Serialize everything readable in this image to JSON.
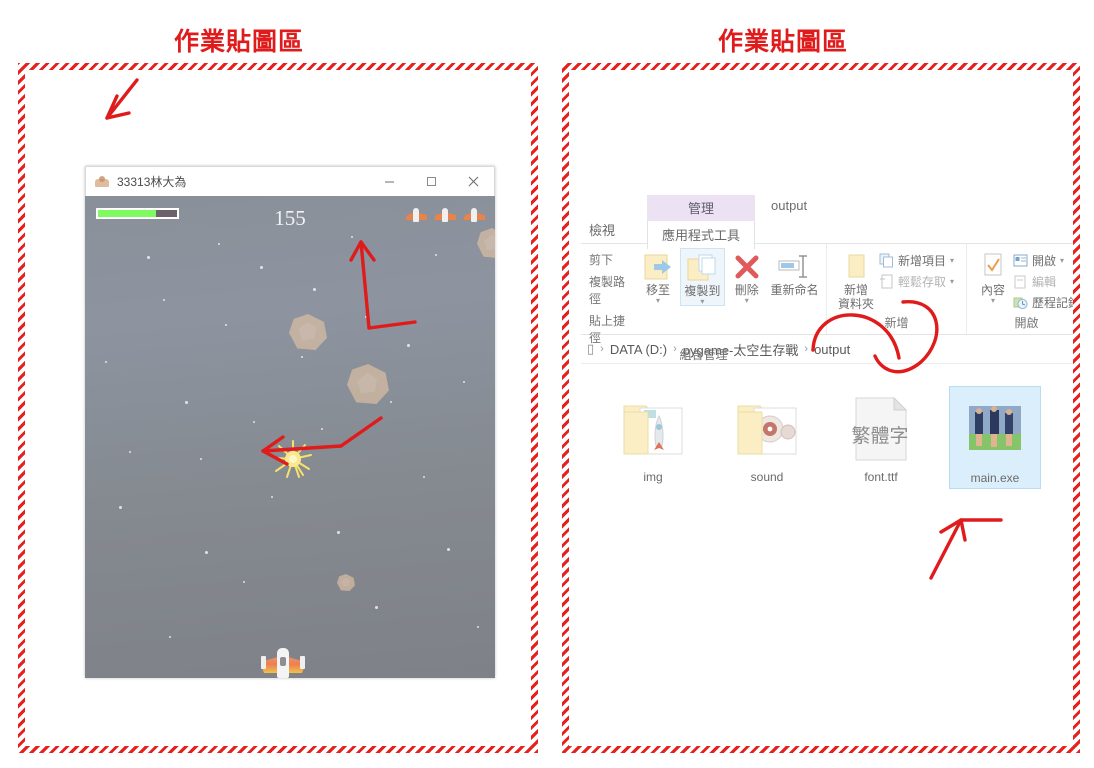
{
  "panels": {
    "left_title": "作業貼圖區",
    "right_title": "作業貼圖區"
  },
  "game_window": {
    "title": "33313林大為",
    "icon": "ship-icon",
    "window_buttons": {
      "minimize": "minimize-icon",
      "maximize": "maximize-icon",
      "close": "close-icon"
    },
    "hud": {
      "score": "155",
      "health_percent": 73,
      "lives": 3
    }
  },
  "explorer": {
    "tabs": {
      "view": "檢視",
      "manage_head": "管理",
      "manage_sub": "應用程式工具",
      "window_title": "output"
    },
    "ribbon": {
      "clipboard": {
        "items": [
          "剪下",
          "複製路徑",
          "貼上捷徑"
        ],
        "move_to": "移至",
        "copy_to": "複製到",
        "delete": "刪除",
        "rename": "重新命名",
        "group_label": "組合管理"
      },
      "new": {
        "new_folder": "新增\n資料夾",
        "new_folder_line1": "新增",
        "new_folder_line2": "資料夾",
        "new_item": "新增項目",
        "easy_access": "輕鬆存取",
        "group_label": "新增"
      },
      "open": {
        "properties": "內容",
        "open": "開啟",
        "edit": "編輯",
        "history": "歷程記錄",
        "group_label": "開啟"
      }
    },
    "breadcrumb": {
      "root": "",
      "items": [
        "DATA (D:)",
        "pygame-太空生存戰",
        "output"
      ]
    },
    "files": [
      {
        "name": "img",
        "type": "folder-rocket-icon",
        "selected": false
      },
      {
        "name": "sound",
        "type": "folder-disc-icon",
        "selected": false
      },
      {
        "name": "font.ttf",
        "type": "font-file-icon",
        "selected": false,
        "preview_text": "繁體字"
      },
      {
        "name": "main.exe",
        "type": "exe-thumbnail-icon",
        "selected": true
      }
    ]
  },
  "annotations": {
    "color": "#e01b1b",
    "marks": [
      "arrow-to-window-title",
      "arrow-hook-right-of-asteroid",
      "arrow-to-explosion",
      "circle-around-new-folder",
      "circle-around-breadcrumb-output",
      "arrow-to-main-exe"
    ]
  },
  "colors": {
    "accent_red": "#e01b1b",
    "health_green": "#7dfb61",
    "selection_blue": "#dbeefb",
    "manage_tab_purple": "#ece2f4"
  }
}
